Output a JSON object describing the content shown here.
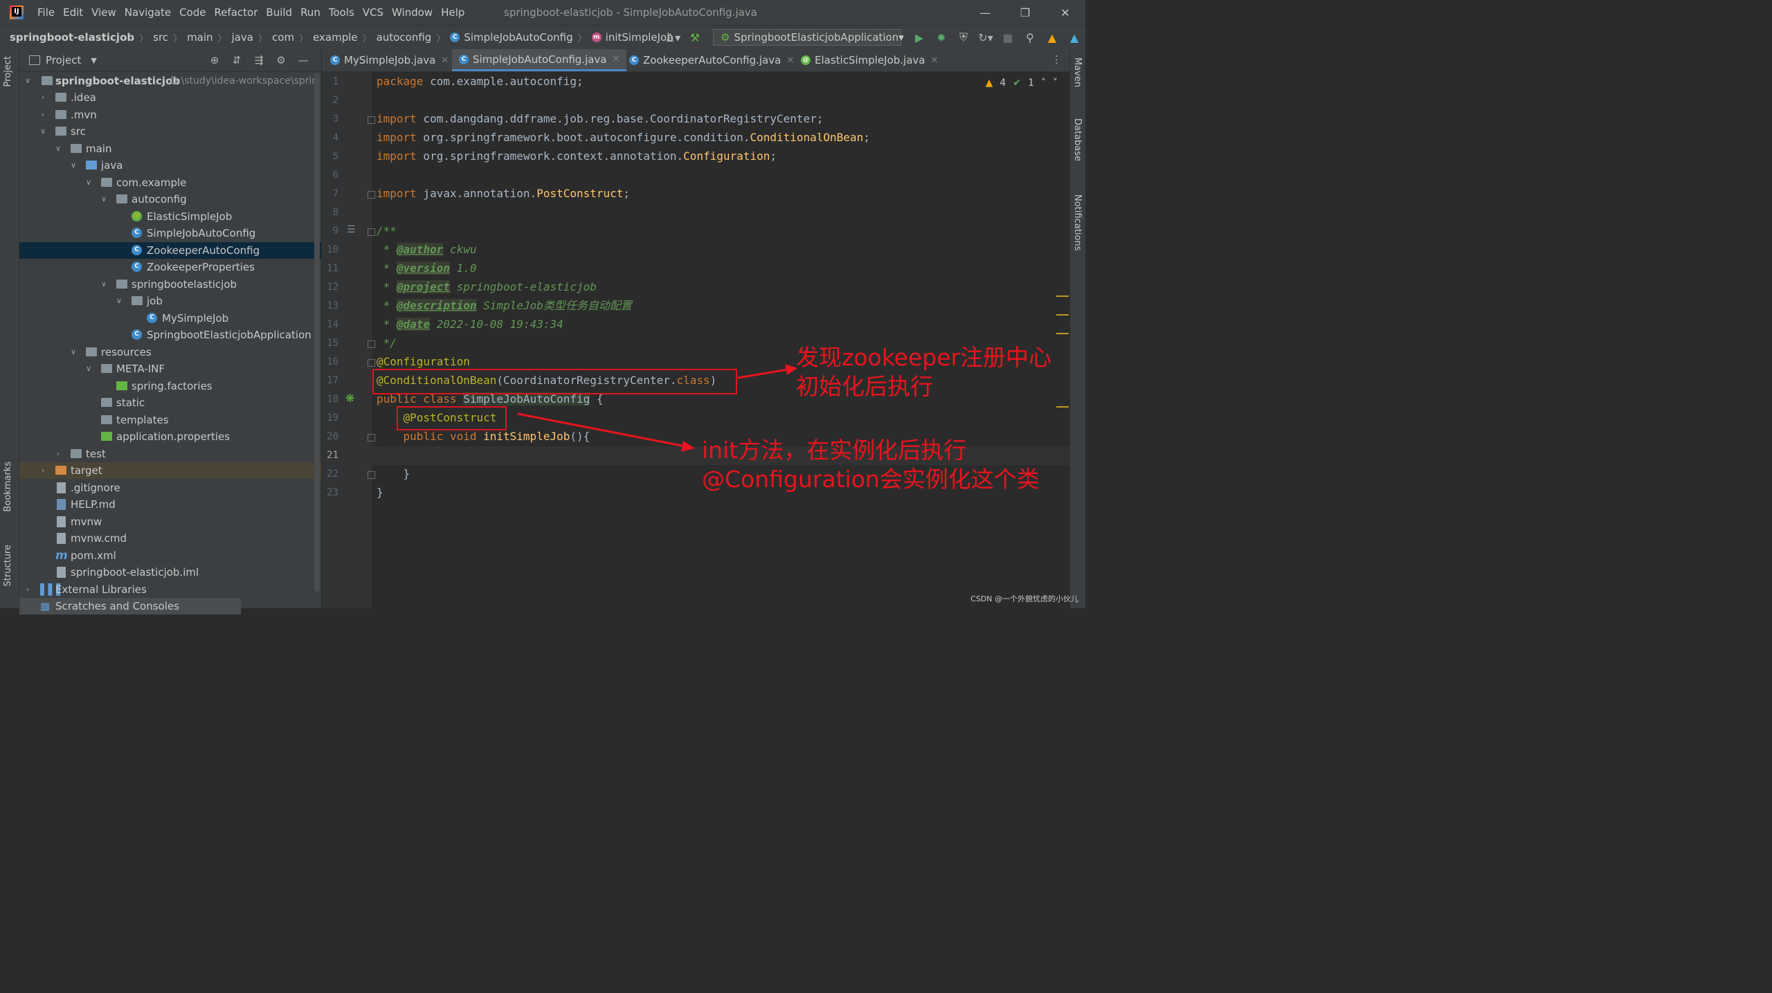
{
  "menubar": {
    "items": [
      "File",
      "Edit",
      "View",
      "Navigate",
      "Code",
      "Refactor",
      "Build",
      "Run",
      "Tools",
      "VCS",
      "Window",
      "Help"
    ],
    "window_title": "springboot-elasticjob - SimpleJobAutoConfig.java"
  },
  "breadcrumb": [
    "springboot-elasticjob",
    "src",
    "main",
    "java",
    "com",
    "example",
    "autoconfig",
    "SimpleJobAutoConfig",
    "initSimpleJob"
  ],
  "run_config": "SpringbootElasticjobApplication",
  "project_panel": {
    "title": "Project",
    "root_name": "springboot-elasticjob",
    "root_path": "D:\\study\\idea-workspace\\sprin",
    "tree": [
      ".idea",
      ".mvn",
      "src",
      "main",
      "java",
      "com.example",
      "autoconfig",
      "ElasticSimpleJob",
      "SimpleJobAutoConfig",
      "ZookeeperAutoConfig",
      "ZookeeperProperties",
      "springbootelasticjob",
      "job",
      "MySimpleJob",
      "SpringbootElasticjobApplication",
      "resources",
      "META-INF",
      "spring.factories",
      "static",
      "templates",
      "application.properties",
      "test",
      "target",
      ".gitignore",
      "HELP.md",
      "mvnw",
      "mvnw.cmd",
      "pom.xml",
      "springboot-elasticjob.iml",
      "External Libraries",
      "Scratches and Consoles"
    ]
  },
  "tabs": [
    "MySimpleJob.java",
    "SimpleJobAutoConfig.java",
    "ZookeeperAutoConfig.java",
    "ElasticSimpleJob.java"
  ],
  "side_labels": {
    "left": [
      "Project",
      "Bookmarks",
      "Structure"
    ],
    "right": [
      "Maven",
      "Database",
      "Notifications"
    ]
  },
  "inspections": {
    "warnings": "4",
    "ok": "1"
  },
  "line_numbers": [
    "1",
    "2",
    "3",
    "4",
    "5",
    "6",
    "7",
    "8",
    "9",
    "10",
    "11",
    "12",
    "13",
    "14",
    "15",
    "16",
    "17",
    "18",
    "19",
    "20",
    "21",
    "22",
    "23"
  ],
  "code": {
    "l1_kw": "package",
    "l1_rest": " com.example.autoconfig;",
    "l3_kw": "import",
    "l3_rest": " com.dangdang.ddframe.job.reg.base.CoordinatorRegistryCenter;",
    "l4_kw": "import",
    "l4_pre": " org.springframework.boot.autoconfigure.condition.",
    "l4_cls": "ConditionalOnBean",
    "l4_end": ";",
    "l5_kw": "import",
    "l5_pre": " org.springframework.context.annotation.",
    "l5_cls": "Configuration",
    "l5_end": ";",
    "l7_kw": "import",
    "l7_pre": " javax.annotation.",
    "l7_cls": "PostConstruct",
    "l7_end": ";",
    "l9": "/**",
    "l10_tag": "@author",
    "l10_val": " ckwu",
    "l11_tag": "@version",
    "l11_val": " 1.0",
    "l12_tag": "@project",
    "l12_val": " springboot-elasticjob",
    "l13_tag": "@description",
    "l13_val": " SimpleJob类型任务自动配置",
    "l14_tag": "@date",
    "l14_val": " 2022-10-08 19:43:34",
    "l15": " */",
    "l16": "@Configuration",
    "l17_anno": "@ConditionalOnBean",
    "l17_a": "(CoordinatorRegistryCenter.",
    "l17_kw": "class",
    "l17_b": ")",
    "l18_kw": "public class ",
    "l18_cls": "SimpleJobAutoConfig",
    "l18_end": " {",
    "l19": "@PostConstruct",
    "l20_kw": "public void ",
    "l20_fn": "initSimpleJob",
    "l20_end": "(){",
    "l22": "}",
    "l23": "}"
  },
  "annotations": {
    "note1_line1": "发现zookeeper注册中心",
    "note1_line2": "初始化后执行",
    "note2_line1": "init方法，在实例化后执行",
    "note2_line2": "@Configuration会实例化这个类"
  },
  "watermark": "CSDN @一个外貌忧虑的小伙儿"
}
